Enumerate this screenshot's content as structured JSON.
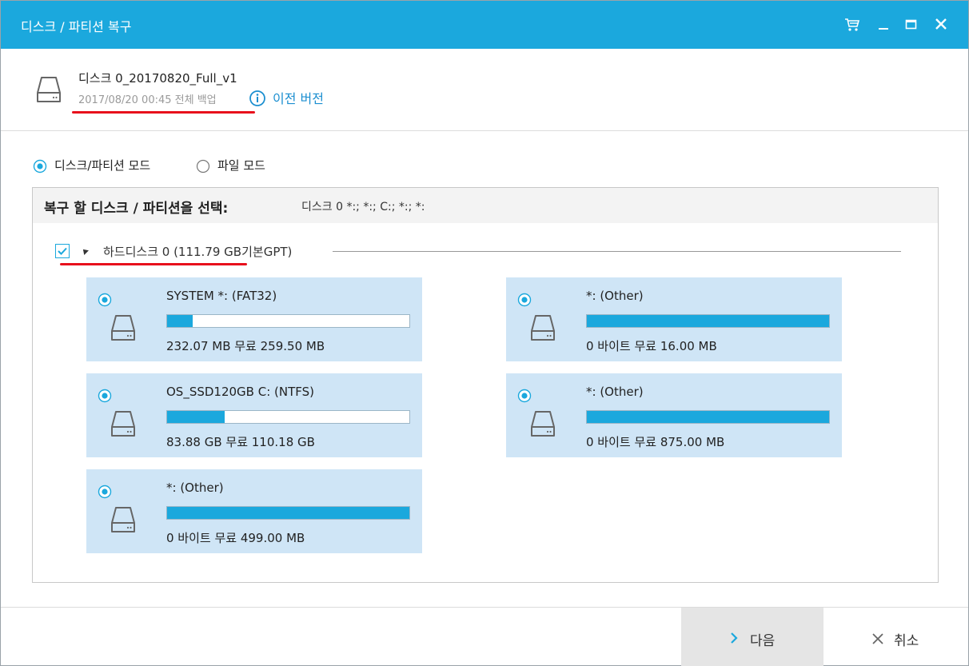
{
  "window": {
    "title": "디스크 / 파티션 복구",
    "icons": [
      "cart-icon",
      "minimize-icon",
      "maximize-icon",
      "close-icon"
    ],
    "accent_color": "#1ba8dd"
  },
  "backup": {
    "name": "디스크 0_20170820_Full_v1",
    "meta": "2017/08/20 00:45 전체 백업",
    "prev_version_label": "이전 버전"
  },
  "modes": [
    {
      "label": "디스크/파티션 모드",
      "selected": true
    },
    {
      "label": "파일 모드",
      "selected": false
    }
  ],
  "panel": {
    "heading": "복구 할 디스크 / 파티션을 선택:",
    "selection": "디스크 0 *:; *:; C:; *:; *:"
  },
  "disk": {
    "label": "하드디스크 0 (111.79 GB기본GPT)",
    "checked": true
  },
  "partitions": [
    {
      "name": "SYSTEM *: (FAT32)",
      "size_text": "232.07 MB 무료 259.50 MB",
      "used_fraction": 0.106
    },
    {
      "name": "*: (Other)",
      "size_text": "0 바이트 무료 16.00 MB",
      "used_fraction": 1.0
    },
    {
      "name": "OS_SSD120GB C: (NTFS)",
      "size_text": "83.88 GB 무료 110.18 GB",
      "used_fraction": 0.239
    },
    {
      "name": "*: (Other)",
      "size_text": "0 바이트 무료 875.00 MB",
      "used_fraction": 1.0
    },
    {
      "name": "*: (Other)",
      "size_text": "0 바이트 무료 499.00 MB",
      "used_fraction": 1.0
    }
  ],
  "footer": {
    "next_label": "다음",
    "cancel_label": "취소"
  },
  "annotation_color": "#e8101c"
}
